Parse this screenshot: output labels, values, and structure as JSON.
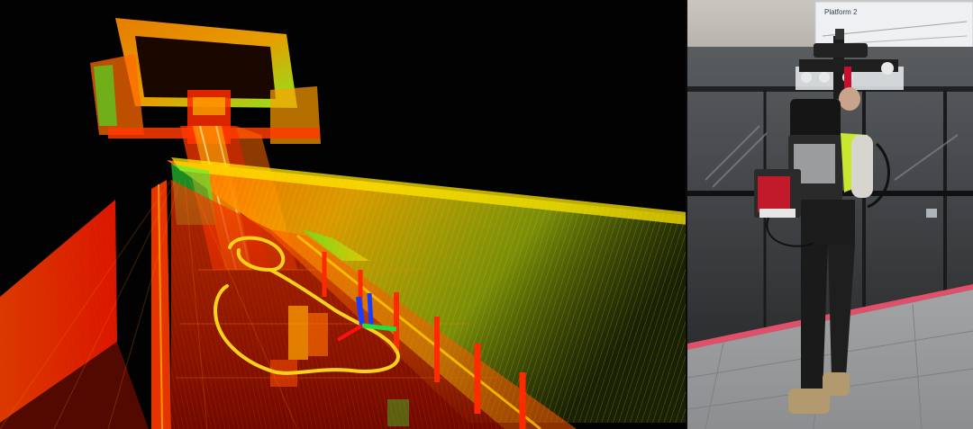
{
  "scene": {
    "left_panel": {
      "kind": "lidar-point-cloud",
      "trajectory_color": "#ffd21a",
      "palette": [
        "#ff2a00",
        "#ff7a00",
        "#ffb000",
        "#c8ff10",
        "#20ff40"
      ]
    },
    "right_panel": {
      "kind": "photo-backpack-scanner",
      "sign_text": "Platform 2",
      "platform_edge_color": "#e0506a"
    }
  }
}
